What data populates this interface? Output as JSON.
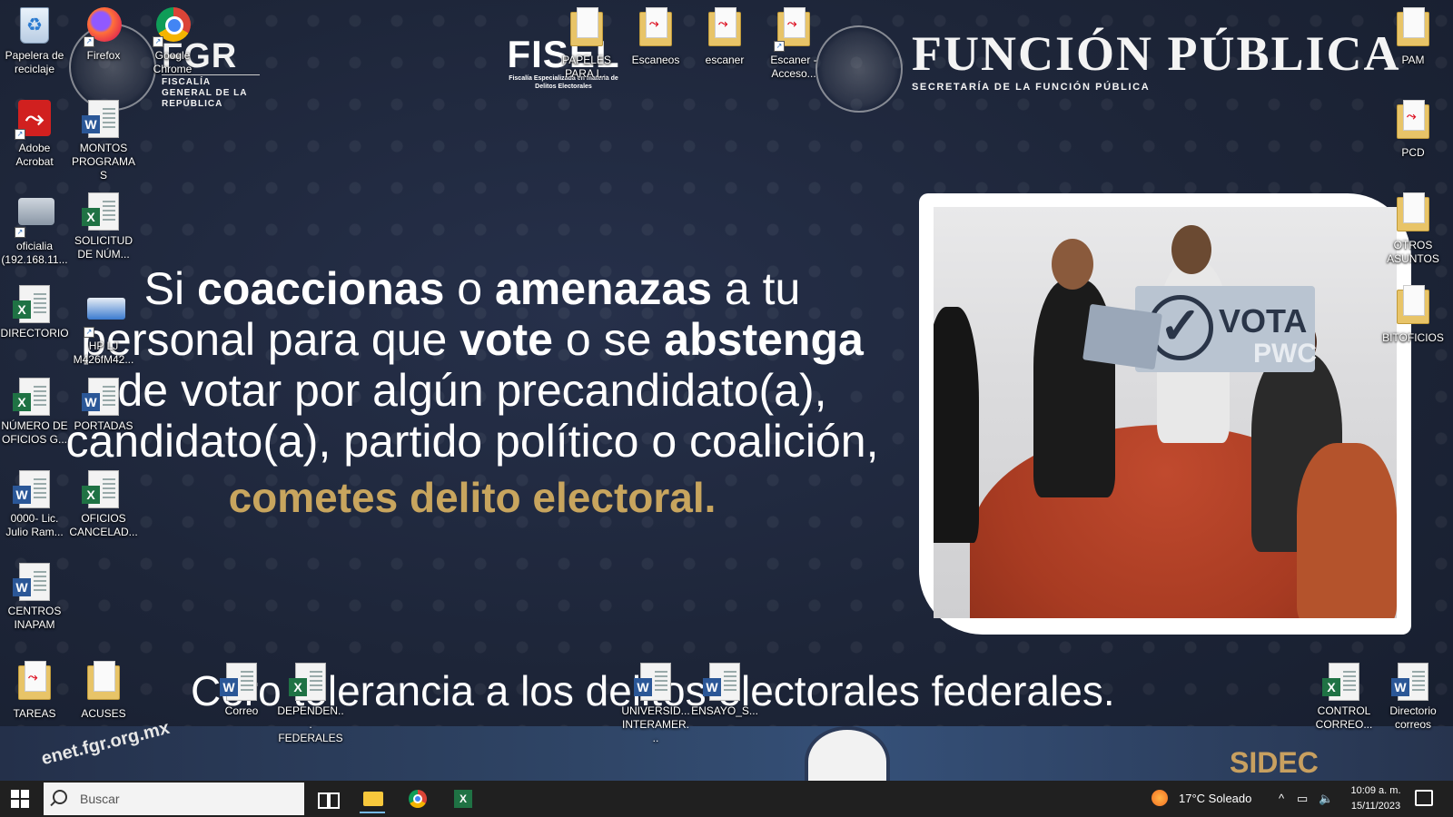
{
  "wallpaper": {
    "fgr_logo": {
      "big": "FGR",
      "sub": "FISCALÍA GENERAL DE LA REPÚBLICA"
    },
    "fisel_logo": {
      "big": "FISEL",
      "sub": "Fiscalía Especializada en materia de Delitos Electorales"
    },
    "funcion_publica": {
      "big": "FUNCIÓN PÚBLICA",
      "sub": "SECRETARÍA DE LA FUNCIÓN PÚBLICA"
    },
    "headline": {
      "l1_a": "Si ",
      "l1_b": "coaccionas",
      "l1_c": " o ",
      "l1_d": "amenazas",
      "l1_e": " a tu",
      "l2_a": "personal para que ",
      "l2_b": "vote",
      "l2_c": " o se ",
      "l2_d": "abstenga",
      "l3": "de votar por algún precandidato(a),",
      "l4": "candidato(a), partido político o coalición,",
      "l5": "cometes delito electoral."
    },
    "photo_sign": {
      "word": "VOTA",
      "party": "PWC",
      "check": "✓"
    },
    "zero_tolerance": "Cero tolerancia a los delitos electorales federales.",
    "footer_left": "enet.fgr.org.mx",
    "footer_right": "SIDEC"
  },
  "desktop_icons": [
    {
      "label": "Papelera de reciclaje",
      "kind": "recycle-bin-icon"
    },
    {
      "label": "Firefox",
      "kind": "firefox-icon"
    },
    {
      "label": "Google Chrome",
      "kind": "chrome-icon"
    },
    {
      "label": "Adobe Acrobat",
      "kind": "acrobat-icon"
    },
    {
      "label": "MONTOS PROGRAMAS",
      "kind": "word-doc-icon"
    },
    {
      "label": "oficialia (192.168.11...",
      "kind": "printer-icon"
    },
    {
      "label": "SOLICITUD DE NÚM...",
      "kind": "excel-doc-icon"
    },
    {
      "label": "DIRECTORIO",
      "kind": "excel-doc-icon"
    },
    {
      "label": "HP LJ M426fM42...",
      "kind": "scanner-icon"
    },
    {
      "label": "NÚMERO DE OFICIOS G...",
      "kind": "excel-doc-icon"
    },
    {
      "label": "PORTADAS",
      "kind": "word-doc-icon"
    },
    {
      "label": "0000- Lic. Julio Ram...",
      "kind": "word-doc-icon"
    },
    {
      "label": "OFICIOS CANCELAD...",
      "kind": "excel-doc-icon"
    },
    {
      "label": "CENTROS INAPAM",
      "kind": "word-doc-icon"
    },
    {
      "label": "TAREAS",
      "kind": "pdf-folder-icon"
    },
    {
      "label": "ACUSES",
      "kind": "folder-icon"
    },
    {
      "label": "Correo",
      "kind": "word-doc-icon"
    },
    {
      "label": "DEPENDEN... FEDERALES",
      "kind": "excel-doc-icon"
    },
    {
      "label": "PAPELES PARA I...",
      "kind": "folder-icon"
    },
    {
      "label": "Escaneos",
      "kind": "pdf-folder-icon"
    },
    {
      "label": "escaner",
      "kind": "pdf-folder-icon"
    },
    {
      "label": "Escaner - Acceso...",
      "kind": "pdf-folder-icon"
    },
    {
      "label": "UNIVERSID... INTERAMER...",
      "kind": "word-doc-icon"
    },
    {
      "label": "ENSAYO_S...",
      "kind": "word-doc-icon"
    },
    {
      "label": "PAM",
      "kind": "folder-icon"
    },
    {
      "label": "PCD",
      "kind": "pdf-folder-icon"
    },
    {
      "label": "OTROS ASUNTOS",
      "kind": "folder-icon"
    },
    {
      "label": "BITOFICIOS",
      "kind": "folder-icon"
    },
    {
      "label": "CONTROL CORREO...",
      "kind": "excel-doc-icon"
    },
    {
      "label": "Directorio correos",
      "kind": "word-doc-icon"
    }
  ],
  "taskbar": {
    "search_placeholder": "Buscar",
    "weather": "17°C  Soleado",
    "time": "10:09 a. m.",
    "date": "15/11/2023",
    "tray_chevron": "^"
  }
}
